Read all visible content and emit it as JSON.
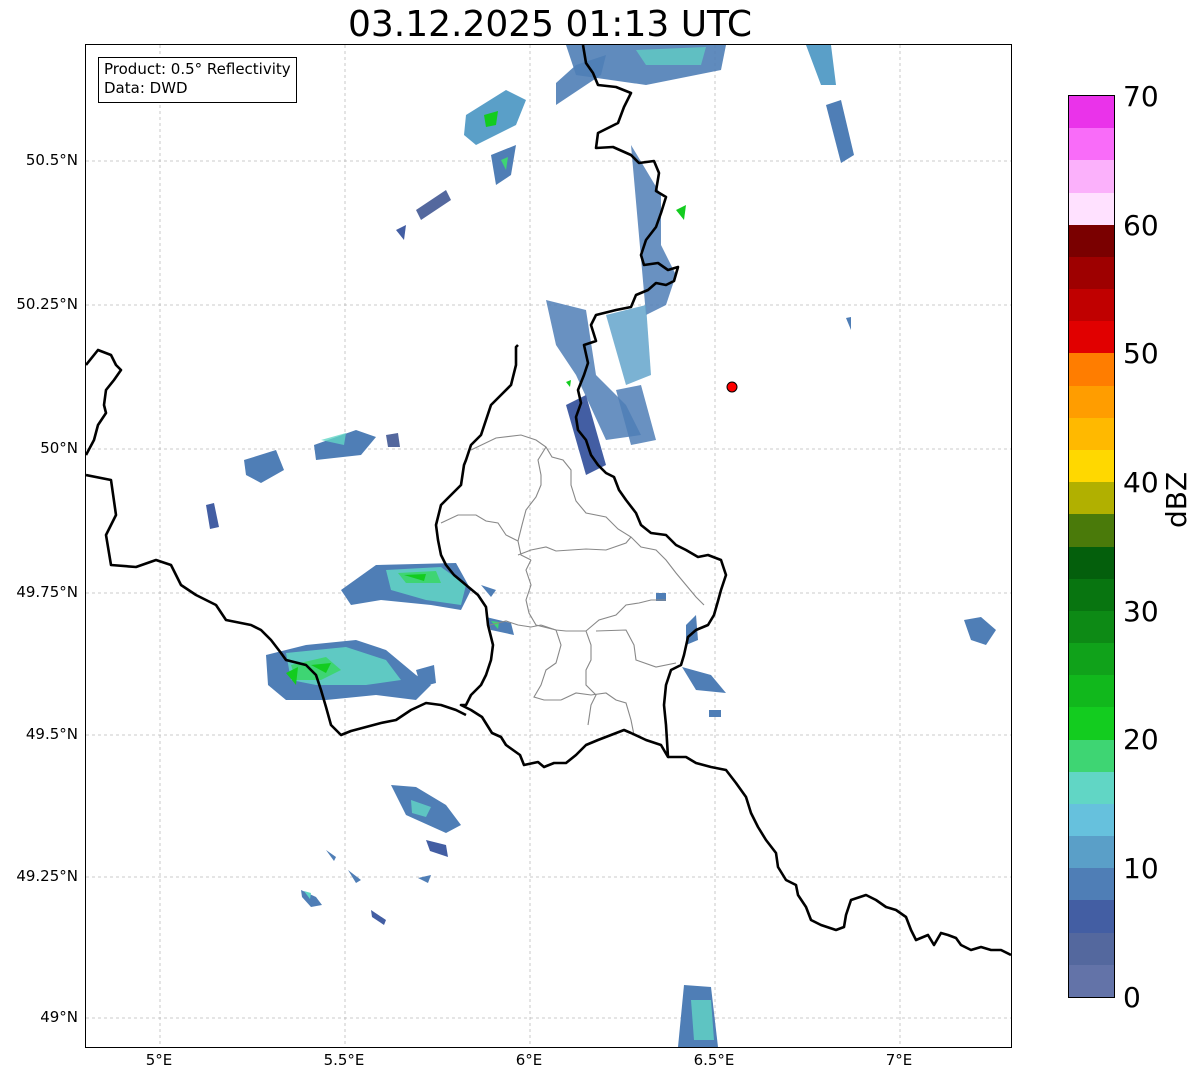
{
  "title": "03.12.2025 01:13 UTC",
  "infobox": {
    "product": "Product: 0.5° Reflectivity",
    "source": "Data: DWD"
  },
  "map": {
    "lon_range": [
      4.8,
      7.3
    ],
    "lat_range": [
      48.95,
      50.7
    ],
    "grid": true,
    "radar_site": {
      "lon": 6.55,
      "lat": 50.11,
      "color": "#ff0000"
    },
    "lat_ticks": [
      "50.5°N",
      "50.25°N",
      "50°N",
      "49.75°N",
      "49.5°N",
      "49.25°N",
      "49°N"
    ],
    "lon_ticks": [
      "5°E",
      "5.5°E",
      "6°E",
      "6.5°E",
      "7°E"
    ]
  },
  "colorbar": {
    "label": "dBZ",
    "ticks": [
      "70",
      "60",
      "50",
      "40",
      "30",
      "20",
      "10",
      "0"
    ],
    "range": [
      0,
      70
    ],
    "colors_top_to_bottom": [
      "#ea33ea",
      "#f96cf9",
      "#fbb1fb",
      "#ffe1ff",
      "#7a0000",
      "#9e0000",
      "#c00000",
      "#e10000",
      "#ff7d00",
      "#ff9d00",
      "#ffb900",
      "#ffd800",
      "#b1b000",
      "#4a7a0a",
      "#045f0c",
      "#087510",
      "#0d8a15",
      "#10a21a",
      "#11b81c",
      "#13cc1f",
      "#3ed573",
      "#61d6c5",
      "#66c1dd",
      "#5a9fc8",
      "#4f7eb6",
      "#435ea3",
      "#54689e",
      "#6373a8"
    ]
  }
}
